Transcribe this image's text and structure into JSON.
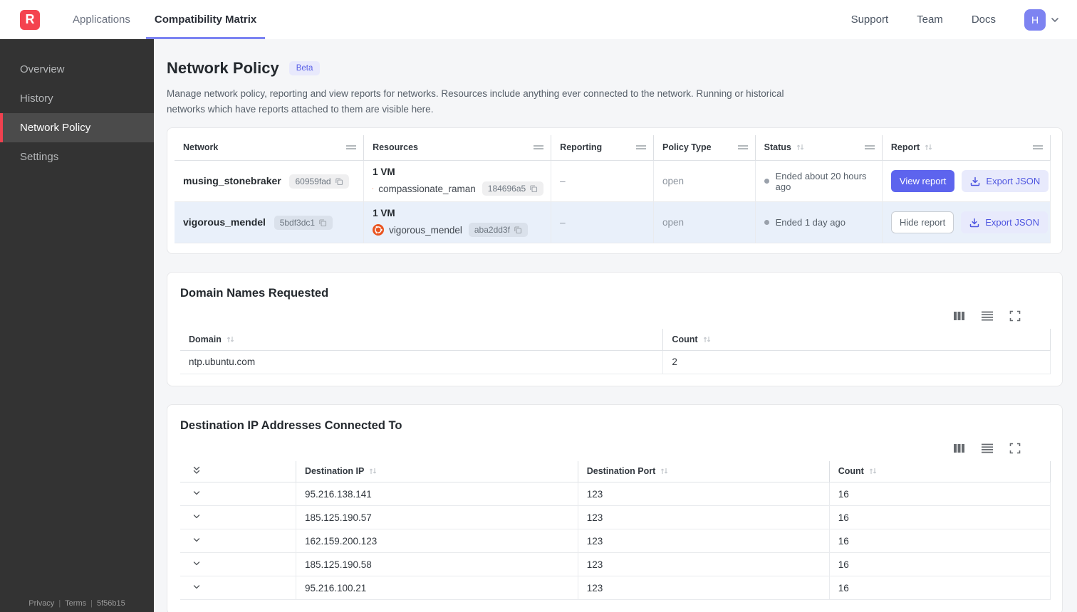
{
  "topnav": {
    "logo_letter": "R",
    "tabs": [
      {
        "label": "Applications",
        "active": false
      },
      {
        "label": "Compatibility Matrix",
        "active": true
      }
    ],
    "links": {
      "support": "Support",
      "team": "Team",
      "docs": "Docs"
    },
    "avatar_initial": "H"
  },
  "sidebar": {
    "items": [
      {
        "label": "Overview"
      },
      {
        "label": "History"
      },
      {
        "label": "Network Policy"
      },
      {
        "label": "Settings"
      }
    ],
    "footer": {
      "privacy": "Privacy",
      "terms": "Terms",
      "build": "5f56b15"
    }
  },
  "page": {
    "title": "Network Policy",
    "beta_badge": "Beta",
    "description": "Manage network policy, reporting and view reports for networks. Resources include anything ever connected to the network. Running or historical networks which have reports attached to them are visible here."
  },
  "networks_table": {
    "headers": {
      "network": "Network",
      "resources": "Resources",
      "reporting": "Reporting",
      "policy_type": "Policy Type",
      "status": "Status",
      "report": "Report"
    },
    "rows": [
      {
        "name": "musing_stonebraker",
        "id": "60959fad",
        "vm_count": "1 VM",
        "resource_name": "compassionate_raman",
        "resource_id": "184696a5",
        "reporting": "–",
        "policy_type": "open",
        "status": "Ended about 20 hours ago",
        "report_button": "View report",
        "export_button": "Export JSON"
      },
      {
        "name": "vigorous_mendel",
        "id": "5bdf3dc1",
        "vm_count": "1 VM",
        "resource_name": "vigorous_mendel",
        "resource_id": "aba2dd3f",
        "reporting": "–",
        "policy_type": "open",
        "status": "Ended 1 day ago",
        "report_button": "Hide report",
        "export_button": "Export JSON"
      }
    ]
  },
  "domains_card": {
    "title": "Domain Names Requested",
    "table": {
      "headers": {
        "domain": "Domain",
        "count": "Count"
      },
      "rows": [
        {
          "domain": "ntp.ubuntu.com",
          "count": "2"
        }
      ]
    }
  },
  "destinations_card": {
    "title": "Destination IP Addresses Connected To",
    "table": {
      "headers": {
        "ip": "Destination IP",
        "port": "Destination Port",
        "count": "Count"
      },
      "rows": [
        {
          "ip": "95.216.138.141",
          "port": "123",
          "count": "16"
        },
        {
          "ip": "185.125.190.57",
          "port": "123",
          "count": "16"
        },
        {
          "ip": "162.159.200.123",
          "port": "123",
          "count": "16"
        },
        {
          "ip": "185.125.190.58",
          "port": "123",
          "count": "16"
        },
        {
          "ip": "95.216.100.21",
          "port": "123",
          "count": "16"
        }
      ]
    }
  },
  "colors": {
    "accent_indigo": "#5d64ee",
    "accent_red": "#f4434f",
    "sidebar_bg": "#333333",
    "highlight_row": "#e9f0fa",
    "ubuntu_orange": "#e95420"
  }
}
